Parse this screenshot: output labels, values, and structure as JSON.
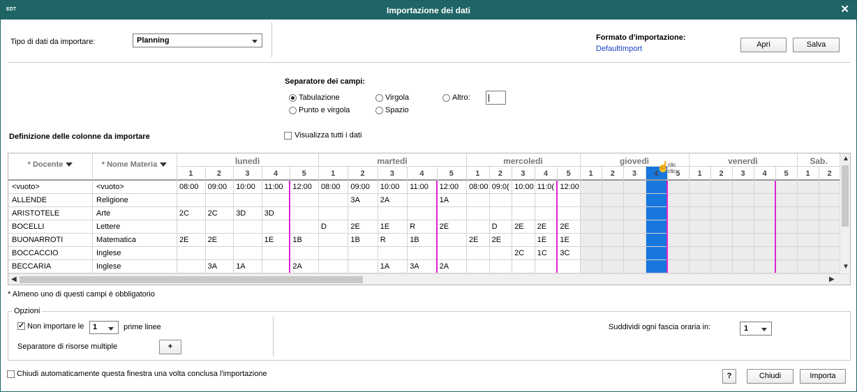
{
  "window": {
    "title": "Importazione dei dati",
    "app_icon": "EDT",
    "close_glyph": "✕"
  },
  "import_type": {
    "label": "Tipo di dati da importare:",
    "value": "Planning"
  },
  "format": {
    "label": "Formato d'importazione:",
    "link": "DefaultImport",
    "open_button": "Apri",
    "save_button": "Salva"
  },
  "separator": {
    "label": "Separatore dei campi:",
    "options": [
      {
        "label": "Tabulazione",
        "selected": true
      },
      {
        "label": "Virgola",
        "selected": false
      },
      {
        "label": "Altro:",
        "selected": false
      },
      {
        "label": "Punto e virgola",
        "selected": false
      },
      {
        "label": "Spazio",
        "selected": false
      }
    ],
    "other_value": ""
  },
  "columns_section": {
    "label": "Definizione delle colonne da importare",
    "show_all_label": "Visualizza tutti i dati",
    "show_all_checked": false
  },
  "table": {
    "col_headers": [
      "* Docente",
      "* Nome Materia"
    ],
    "days": [
      {
        "name": "lunedì",
        "slots": [
          "1",
          "2",
          "3",
          "4",
          "5"
        ]
      },
      {
        "name": "martedì",
        "slots": [
          "1",
          "2",
          "3",
          "4",
          "5"
        ]
      },
      {
        "name": "mercoledì",
        "slots": [
          "1",
          "2",
          "3",
          "4",
          "5"
        ]
      },
      {
        "name": "giovedì",
        "slots": [
          "1",
          "2",
          "3",
          "4",
          "5"
        ]
      },
      {
        "name": "venerdì",
        "slots": [
          "1",
          "2",
          "3",
          "4",
          "5"
        ]
      },
      {
        "name": "Sab.",
        "slots": [
          "1",
          "2"
        ]
      }
    ],
    "rows": [
      {
        "docente": "<vuoto>",
        "materia": "<vuoto>",
        "cells": [
          "08:00",
          "09:00",
          "10:00",
          "11:00",
          "12:00",
          "08:00",
          "09:00",
          "10:00",
          "11:00",
          "12:00",
          "08:00",
          "09:0(",
          "10:00",
          "11:0(",
          "12:00"
        ]
      },
      {
        "docente": "ALLENDE",
        "materia": "Religione",
        "cells": [
          "",
          "",
          "",
          "",
          "",
          "",
          "3A",
          "2A",
          "",
          "1A",
          "",
          "",
          "",
          "",
          ""
        ]
      },
      {
        "docente": "ARISTOTELE",
        "materia": "Arte",
        "cells": [
          "2C",
          "2C",
          "3D",
          "3D",
          "",
          "",
          "",
          "",
          "",
          "",
          "",
          "",
          "",
          "",
          ""
        ]
      },
      {
        "docente": "BOCELLI",
        "materia": "Lettere",
        "cells": [
          "",
          "",
          "",
          "",
          "",
          "D",
          "2E",
          "1E",
          "R",
          "2E",
          "",
          "D",
          "2E",
          "2E",
          "2E"
        ]
      },
      {
        "docente": "BUONARROTI",
        "materia": "Matematica",
        "cells": [
          "2E",
          "2E",
          "",
          "1E",
          "1B",
          "",
          "1B",
          "R",
          "1B",
          "",
          "2E",
          "2E",
          "",
          "1E",
          "1E"
        ]
      },
      {
        "docente": "BOCCACCIO",
        "materia": "Inglese",
        "cells": [
          "",
          "",
          "",
          "",
          "",
          "",
          "",
          "",
          "",
          "",
          "",
          "",
          "2C",
          "1C",
          "3C"
        ]
      },
      {
        "docente": "BECCARIA",
        "materia": "Inglese",
        "cells": [
          "",
          "3A",
          "1A",
          "",
          "2A",
          "",
          "",
          "1A",
          "3A",
          "2A",
          "",
          "",
          "",
          "",
          ""
        ]
      }
    ],
    "cursor_text": [
      "clic",
      "clic"
    ]
  },
  "required_note": "* Almeno uno di questi campi è obbligatorio",
  "options": {
    "label": "Opzioni",
    "skip_label": "Non importare le",
    "skip_checked": true,
    "skip_value": "1",
    "skip_suffix": "prime linee",
    "multi_sep_label": "Separatore di risorse multiple",
    "multi_sep_value": "+",
    "split_label": "Suddividi ogni fascia oraria in:",
    "split_value": "1"
  },
  "footer": {
    "auto_close_label": "Chiudi automaticamente questa finestra una volta conclusa l'importazione",
    "auto_close_checked": false,
    "help": "?",
    "close_button": "Chiudi",
    "import_button": "Importa"
  }
}
